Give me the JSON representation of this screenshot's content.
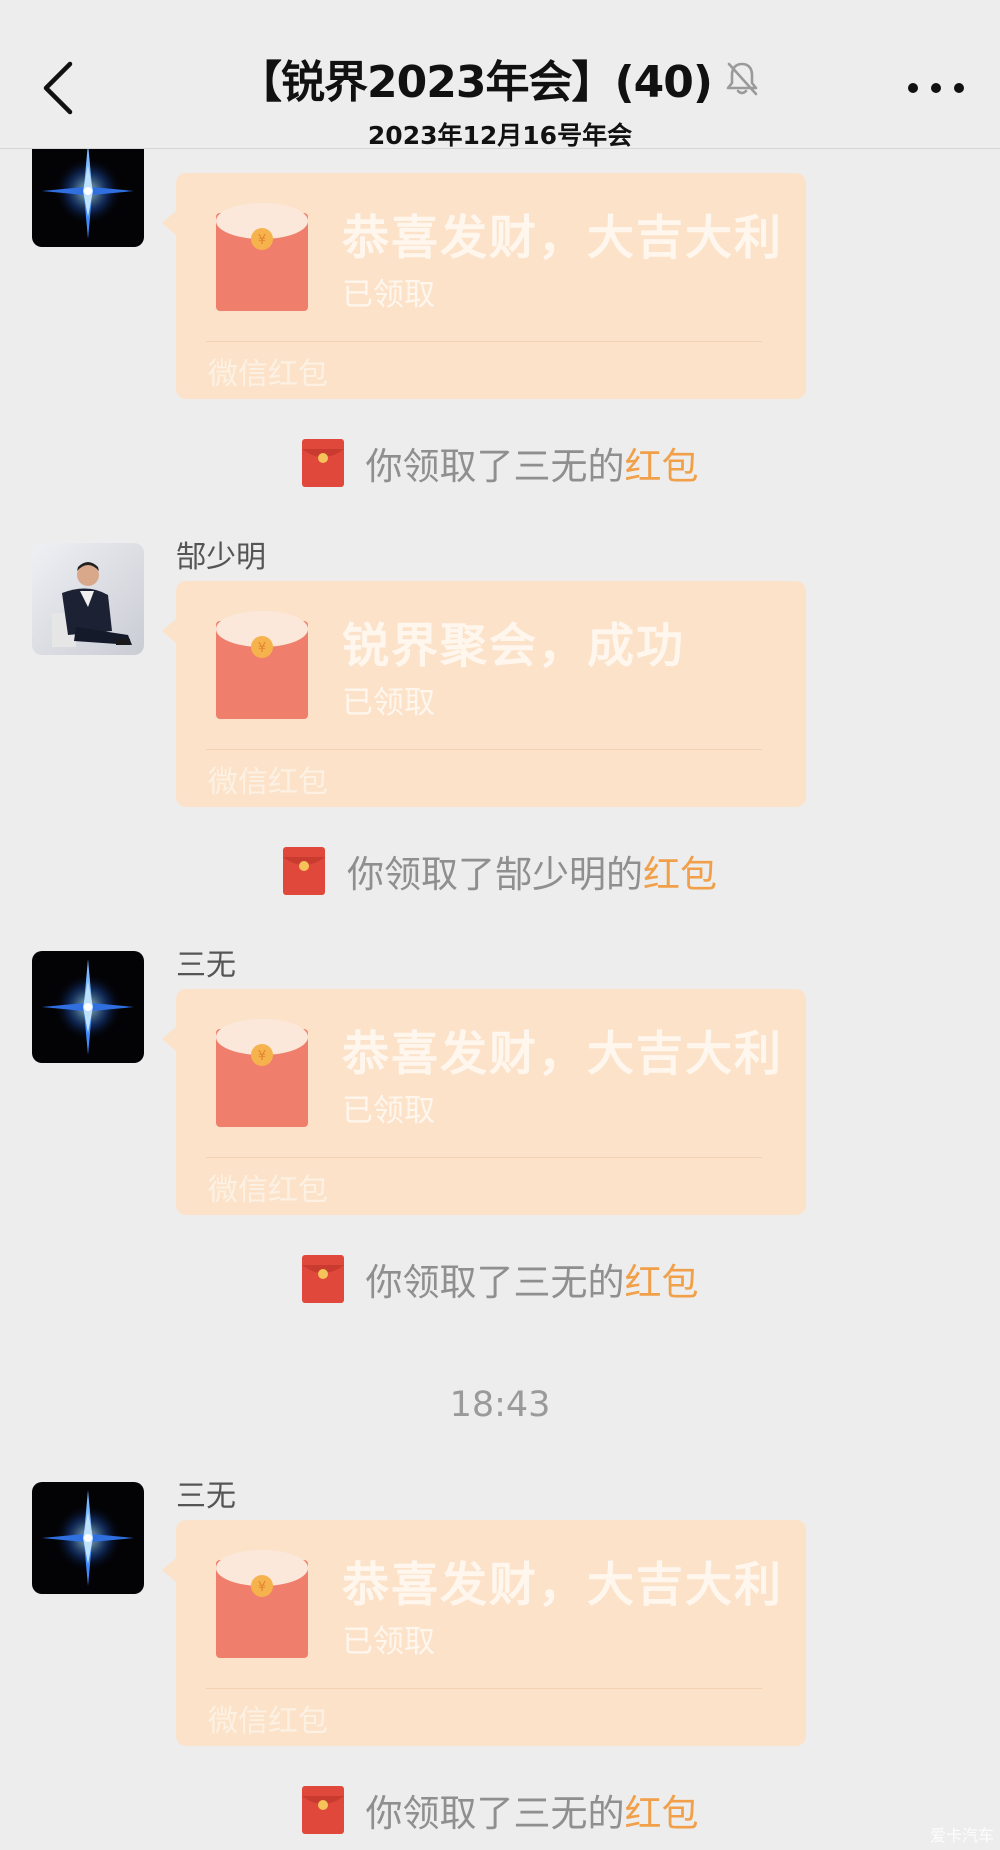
{
  "header": {
    "title": "【锐界2023年会】(40)",
    "subtitle": "2023年12月16号年会"
  },
  "messages": [
    {
      "sender": "",
      "avatar": "blue-star-avatar",
      "blessing": "恭喜发财，大吉大利",
      "status": "已领取",
      "footer": "微信红包",
      "receipt_prefix": "你领取了三无的",
      "receipt_highlight": "红包"
    },
    {
      "sender": "郜少明",
      "avatar": "man-in-suit-photo-avatar",
      "blessing": "锐界聚会，成功",
      "status": "已领取",
      "footer": "微信红包",
      "receipt_prefix": "你领取了郜少明的",
      "receipt_highlight": "红包"
    },
    {
      "sender": "三无",
      "avatar": "blue-star-avatar",
      "blessing": "恭喜发财，大吉大利",
      "status": "已领取",
      "footer": "微信红包",
      "receipt_prefix": "你领取了三无的",
      "receipt_highlight": "红包"
    },
    {
      "sender": "三无",
      "avatar": "blue-star-avatar",
      "blessing": "恭喜发财，大吉大利",
      "status": "已领取",
      "footer": "微信红包",
      "receipt_prefix": "你领取了三无的",
      "receipt_highlight": "红包"
    }
  ],
  "timestamp": "18:43",
  "watermark": "爱卡汽车",
  "colors": {
    "bubble": "#fbe2c9",
    "envelope": "#ef7f6c",
    "envelope_flap": "#fbe8da",
    "receipt_highlight": "#f1a049",
    "background": "#ededed"
  },
  "icons": {
    "back": "back-chevron-icon",
    "mute": "bell-slash-icon",
    "more": "more-dots-icon",
    "red_packet": "red-envelope-icon"
  }
}
